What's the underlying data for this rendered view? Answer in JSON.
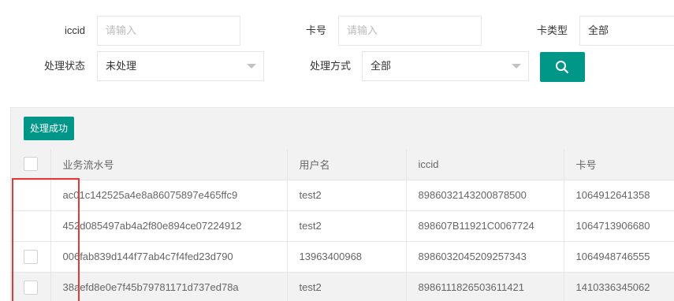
{
  "filters": {
    "iccid": {
      "label": "iccid",
      "placeholder": "请输入"
    },
    "card_no": {
      "label": "卡号",
      "placeholder": "请输入"
    },
    "card_type": {
      "label": "卡类型",
      "value": "全部"
    },
    "status": {
      "label": "处理状态",
      "value": "未处理"
    },
    "method": {
      "label": "处理方式",
      "value": "全部"
    },
    "search_icon": "search-icon"
  },
  "toolbar": {
    "success_label": "处理成功"
  },
  "table": {
    "columns": [
      "业务流水号",
      "用户名",
      "iccid",
      "卡号"
    ],
    "rows": [
      {
        "serial": "ac01c142525a4e8a86075897e465ffc9",
        "user": "test2",
        "iccid": "8986032143200878500",
        "card": "1064912641358",
        "checkbox": false
      },
      {
        "serial": "452d085497ab4a2f80e894ce07224912",
        "user": "test2",
        "iccid": "898607B11921C0067724",
        "card": "1064713906680",
        "checkbox": false
      },
      {
        "serial": "006fab839d144f77ab4c7f4fed23d790",
        "user": "13963400968",
        "iccid": "8986032045209257343",
        "card": "1064948746555",
        "checkbox": true
      },
      {
        "serial": "38aefd8e0e7f45b79781171d737ed78a",
        "user": "test2",
        "iccid": "8986111826503611421",
        "card": "1410336345062",
        "checkbox": true
      }
    ]
  },
  "colors": {
    "accent": "#009688",
    "annotation": "#e53935"
  }
}
